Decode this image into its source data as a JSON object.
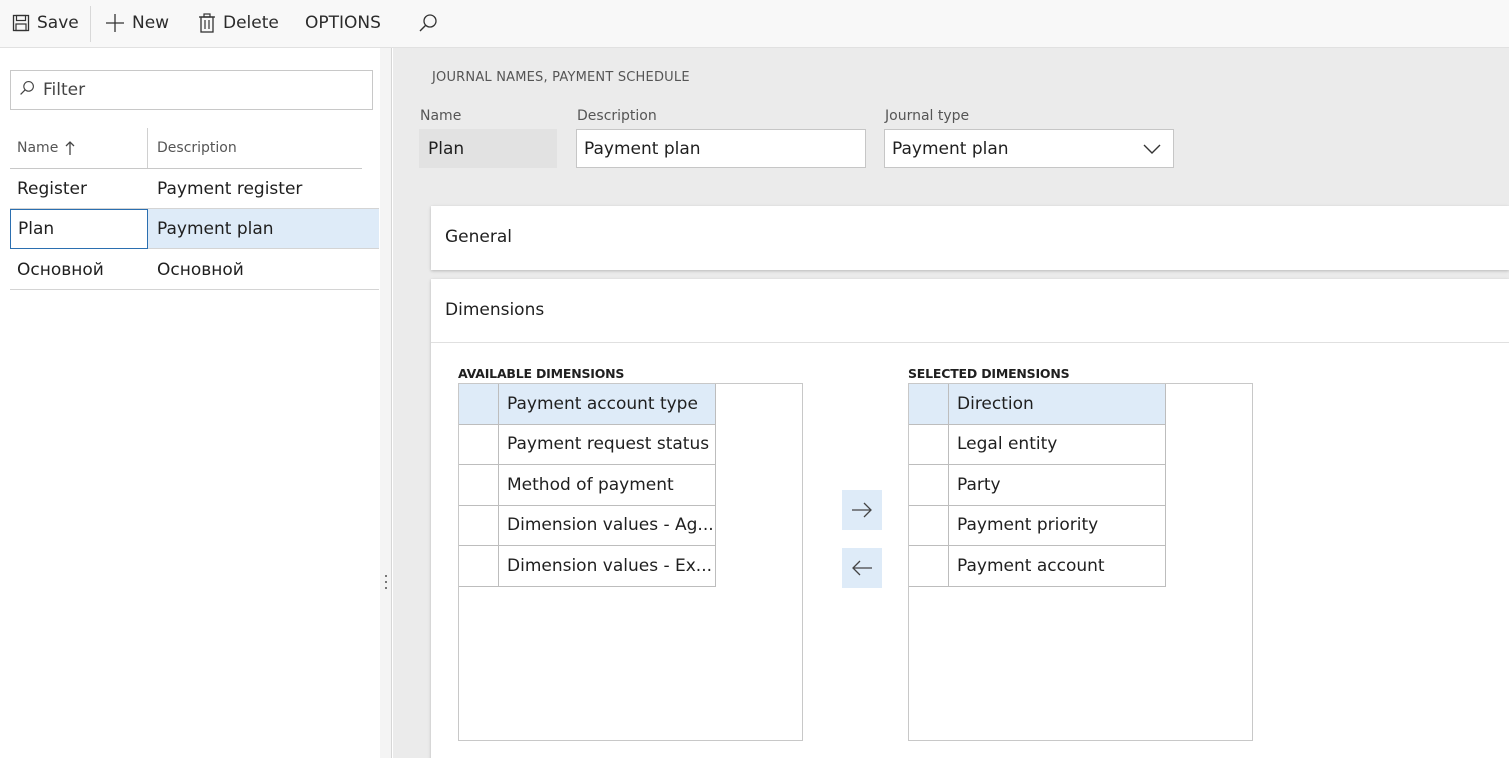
{
  "toolbar": {
    "save_label": "Save",
    "new_label": "New",
    "delete_label": "Delete",
    "options_label": "OPTIONS"
  },
  "left": {
    "filter_placeholder": "Filter",
    "columns": {
      "name": "Name",
      "description": "Description"
    },
    "rows": [
      {
        "name": "Register",
        "description": "Payment register"
      },
      {
        "name": "Plan",
        "description": "Payment plan"
      },
      {
        "name": "Основной",
        "description": "Основной"
      }
    ]
  },
  "header": {
    "caption": "JOURNAL NAMES, PAYMENT SCHEDULE",
    "name_label": "Name",
    "name_value": "Plan",
    "description_label": "Description",
    "description_value": "Payment plan",
    "journal_type_label": "Journal type",
    "journal_type_value": "Payment plan"
  },
  "sections": {
    "general": "General",
    "dimensions": "Dimensions"
  },
  "dimensions": {
    "available_label": "AVAILABLE DIMENSIONS",
    "selected_label": "SELECTED DIMENSIONS",
    "available": [
      "Payment account type",
      "Payment request status",
      "Method of payment",
      "Dimension values - Ag...",
      "Dimension values - Ex..."
    ],
    "selected": [
      "Direction",
      "Legal entity",
      "Party",
      "Payment priority",
      "Payment account"
    ]
  },
  "colors": {
    "selection": "#deebf8",
    "focus_border": "#2b6fb0",
    "content_bg": "#ebebeb"
  }
}
